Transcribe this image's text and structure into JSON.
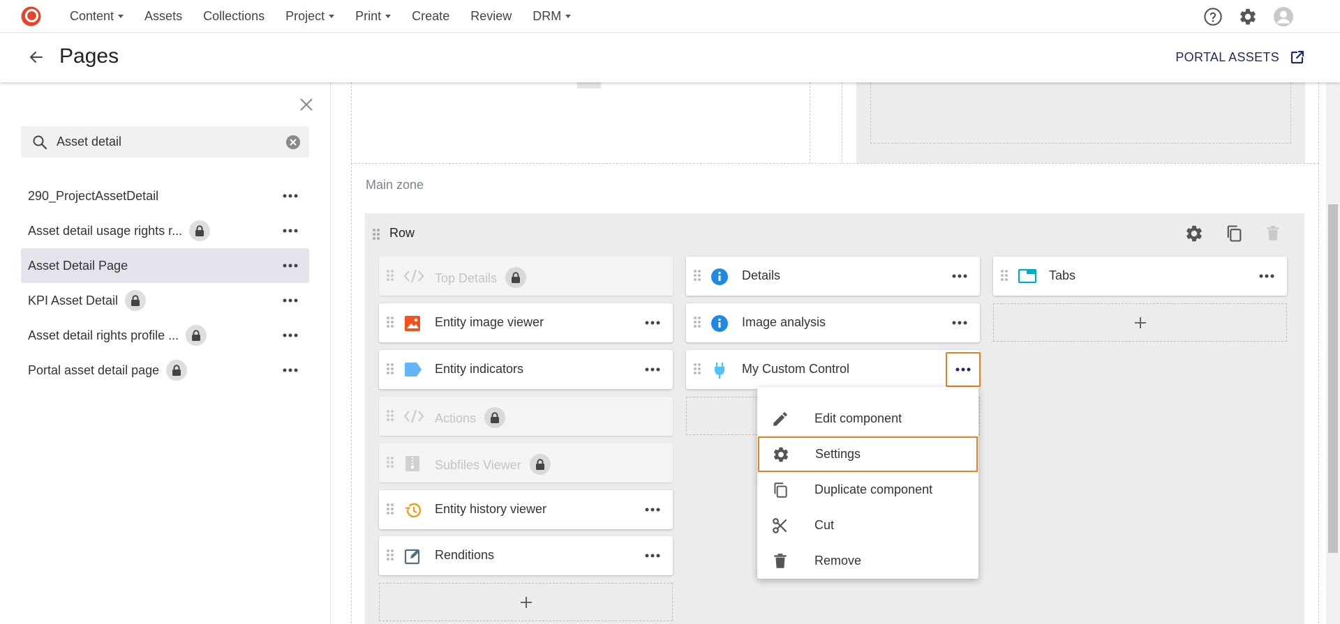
{
  "nav": {
    "items": [
      {
        "label": "Content",
        "has_dropdown": true
      },
      {
        "label": "Assets",
        "has_dropdown": false
      },
      {
        "label": "Collections",
        "has_dropdown": false
      },
      {
        "label": "Project",
        "has_dropdown": true
      },
      {
        "label": "Print",
        "has_dropdown": true
      },
      {
        "label": "Create",
        "has_dropdown": false
      },
      {
        "label": "Review",
        "has_dropdown": false
      },
      {
        "label": "DRM",
        "has_dropdown": true
      }
    ],
    "icons": [
      "help-icon",
      "gear-icon",
      "user-avatar-icon"
    ]
  },
  "header": {
    "title": "Pages",
    "portal_link": "PORTAL ASSETS"
  },
  "sidebar": {
    "search_value": "Asset detail",
    "items": [
      {
        "label": "290_ProjectAssetDetail",
        "locked": false,
        "selected": false
      },
      {
        "label": "Asset detail usage rights r...",
        "locked": true,
        "selected": false
      },
      {
        "label": "Asset Detail Page",
        "locked": false,
        "selected": true
      },
      {
        "label": "KPI Asset Detail",
        "locked": true,
        "selected": false
      },
      {
        "label": "Asset detail rights profile ...",
        "locked": true,
        "selected": false
      },
      {
        "label": "Portal asset detail page",
        "locked": true,
        "selected": false
      }
    ]
  },
  "main": {
    "zone_label": "Main zone",
    "row_label": "Row",
    "columns": [
      [
        {
          "label": "Top Details",
          "icon": "code-icon",
          "disabled": true,
          "locked": true
        },
        {
          "label": "Entity image viewer",
          "icon": "image-icon",
          "disabled": false
        },
        {
          "label": "Entity indicators",
          "icon": "label-icon",
          "disabled": false
        },
        {
          "label": "Actions",
          "icon": "code-icon",
          "disabled": true,
          "locked": true
        },
        {
          "label": "Subfiles Viewer",
          "icon": "zip-icon",
          "disabled": true,
          "locked": true
        },
        {
          "label": "Entity history viewer",
          "icon": "history-icon",
          "disabled": false
        },
        {
          "label": "Renditions",
          "icon": "edit-square-icon",
          "disabled": false
        }
      ],
      [
        {
          "label": "Details",
          "icon": "info-icon",
          "disabled": false
        },
        {
          "label": "Image analysis",
          "icon": "info-icon",
          "disabled": false
        },
        {
          "label": "My Custom Control",
          "icon": "plug-icon",
          "disabled": false
        }
      ],
      [
        {
          "label": "Tabs",
          "icon": "tabs-icon",
          "disabled": false
        }
      ]
    ]
  },
  "context_menu": {
    "items": [
      {
        "label": "Edit component",
        "icon": "pencil-icon"
      },
      {
        "label": "Settings",
        "icon": "gear-icon",
        "highlighted": true
      },
      {
        "label": "Duplicate component",
        "icon": "copy-icon"
      },
      {
        "label": "Cut",
        "icon": "scissors-icon"
      },
      {
        "label": "Remove",
        "icon": "trash-icon"
      }
    ]
  },
  "colors": {
    "brand_red": "#e8412c",
    "highlight_orange": "#f07d1a",
    "info_blue": "#1e88e5",
    "selected_bg": "#e4e4ed",
    "portal_navy": "#1c2a5e"
  }
}
